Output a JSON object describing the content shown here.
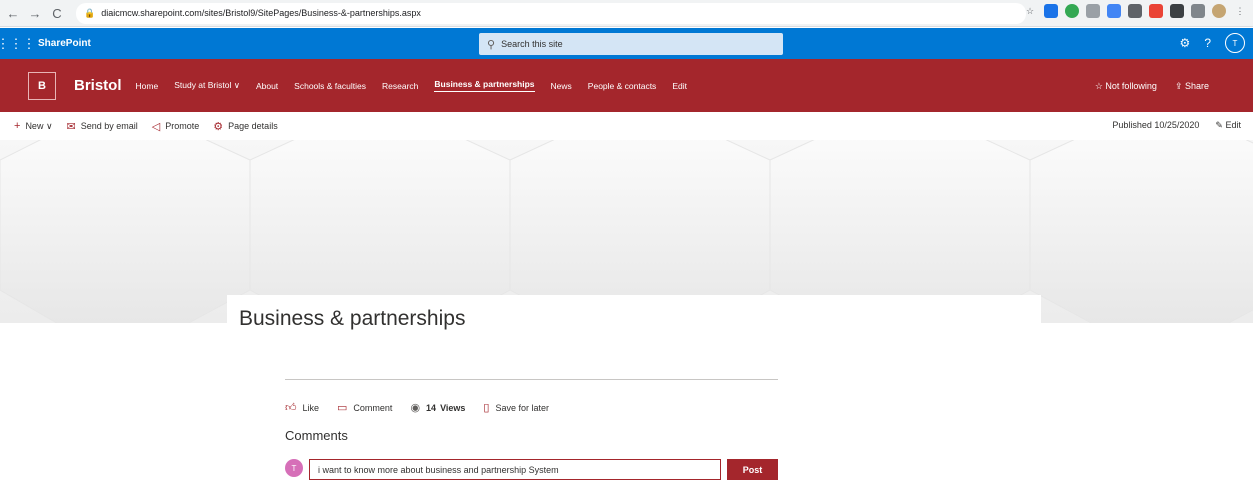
{
  "browser": {
    "url": "diaicmcw.sharepoint.com/sites/Bristol9/SitePages/Business-&-partnerships.aspx",
    "back_icon": "←",
    "forward_icon": "→",
    "reload_icon": "C",
    "lock_icon": "lock-icon",
    "star_icon": "☆",
    "menu_icon": "⋮"
  },
  "suite": {
    "waffle_icon": "app-launcher-icon",
    "title": "SharePoint",
    "search_placeholder": "Search this site",
    "settings_icon": "⚙",
    "help_icon": "?",
    "avatar_initial": "T"
  },
  "site": {
    "logo_letter": "B",
    "name": "Bristol",
    "nav": [
      {
        "label": "Home"
      },
      {
        "label": "Study at Bristol ∨"
      },
      {
        "label": "About"
      },
      {
        "label": "Schools & faculties"
      },
      {
        "label": "Research"
      },
      {
        "label": "Business & partnerships",
        "active": true
      },
      {
        "label": "News"
      },
      {
        "label": "People & contacts"
      },
      {
        "label": "Edit"
      }
    ],
    "follow_label": "☆ Not following",
    "share_label": "⇪ Share"
  },
  "commandbar": {
    "new_label": "New ∨",
    "send_label": "Send by email",
    "promote_label": "Promote",
    "details_label": "Page details",
    "published_label": "Published 10/25/2020",
    "edit_label": "Edit"
  },
  "page": {
    "title": "Business & partnerships"
  },
  "social": {
    "like_label": "Like",
    "comment_label": "Comment",
    "views_count": "14",
    "views_label": "Views",
    "save_label": "Save for later"
  },
  "comments": {
    "heading": "Comments",
    "avatar_initial": "T",
    "input_value": "i want to know more about business and partnership System",
    "post_label": "Post"
  },
  "colors": {
    "suite_blue": "#0078d4",
    "site_red": "#a4262c"
  }
}
